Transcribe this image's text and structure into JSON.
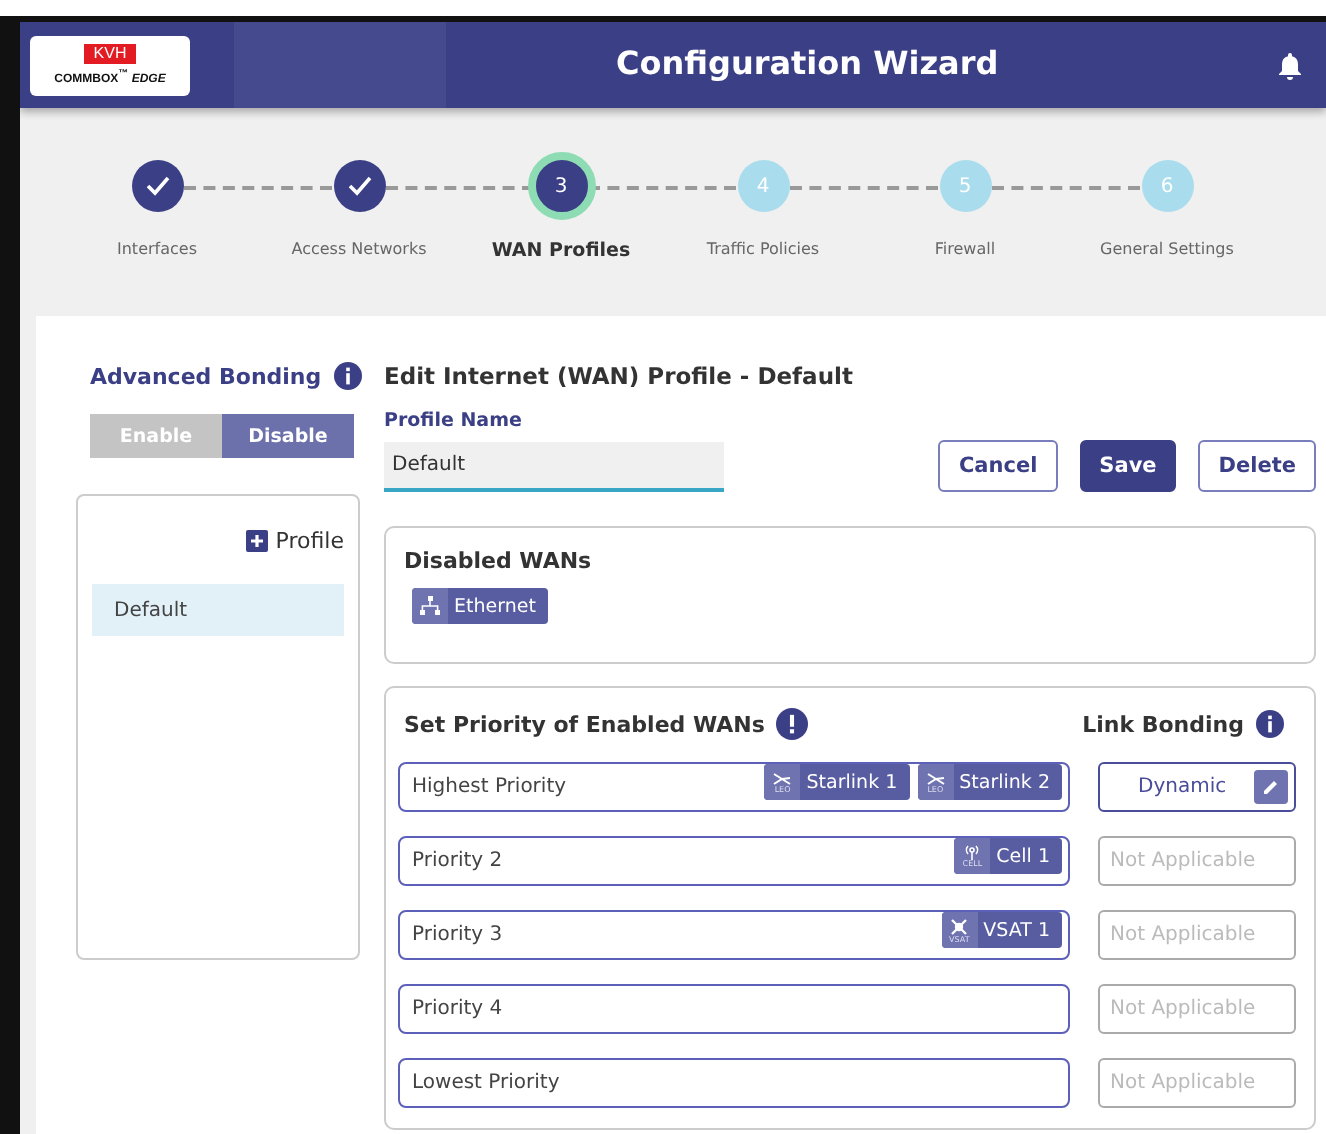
{
  "header": {
    "logo": {
      "brand": "KVH",
      "product": "COMMBOX$^{™}$ *EDGE*"
    },
    "title": "Configuration Wizard"
  },
  "steps": [
    {
      "label": "Interfaces",
      "completed": true,
      "selected": false
    },
    {
      "label": "Access Networks",
      "completed": true,
      "selected": false
    },
    {
      "number": "3",
      "label": "WAN Profiles",
      "completed": false,
      "selected": true
    },
    {
      "number": "4",
      "label": "Traffic Policies",
      "completed": false,
      "selected": false
    },
    {
      "number": "5",
      "label": "Firewall",
      "completed": false,
      "selected": false
    },
    {
      "number": "6",
      "label": "General Settings",
      "completed": false,
      "selected": false
    }
  ],
  "sidebar": {
    "title": "Advanced Bonding",
    "toggle": [
      {
        "label": "Enable",
        "selected": false
      },
      {
        "label": "Disable",
        "selected": true
      }
    ],
    "add_label": "Profile",
    "profiles": [
      {
        "label": "Default",
        "selected": true
      }
    ]
  },
  "editor": {
    "title": "Edit Internet (WAN) Profile - Default",
    "profile_name_label": "Profile Name",
    "profile_name_value": "Default",
    "buttons": [
      {
        "label": "Cancel",
        "kind": "outline"
      },
      {
        "label": "Save",
        "kind": "primary"
      },
      {
        "label": "Delete",
        "kind": "outline"
      }
    ],
    "disabled_wans": {
      "title": "Disabled WANs",
      "tags": [
        {
          "label": "Ethernet",
          "kind": "ethernet"
        }
      ]
    },
    "priorities": {
      "title": "Set Priority of Enabled WANs",
      "bonding_title": "Link Bonding",
      "rows": [
        {
          "label": "Highest Priority",
          "tags": [
            {
              "label": "Starlink 1",
              "kind": "satellite",
              "icon_label": "LEO"
            },
            {
              "label": "Starlink 2",
              "kind": "satellite",
              "icon_label": "LEO"
            }
          ],
          "bonding": {
            "kind": "value",
            "text": "Dynamic"
          }
        },
        {
          "label": "Priority 2",
          "tags": [
            {
              "label": "Cell 1",
              "kind": "cell",
              "icon_label": "CELL"
            }
          ],
          "bonding": {
            "kind": "not_applicable",
            "text": "Not Applicable"
          }
        },
        {
          "label": "Priority 3",
          "tags": [
            {
              "label": "VSAT 1",
              "kind": "vsat",
              "icon_label": "VSAT"
            }
          ],
          "bonding": {
            "kind": "not_applicable",
            "text": "Not Applicable"
          }
        },
        {
          "label": "Priority 4",
          "tags": [],
          "bonding": {
            "kind": "not_applicable",
            "text": "Not Applicable"
          }
        },
        {
          "label": "Lowest Priority",
          "tags": [],
          "bonding": {
            "kind": "not_applicable",
            "text": "Not Applicable"
          }
        }
      ]
    }
  }
}
